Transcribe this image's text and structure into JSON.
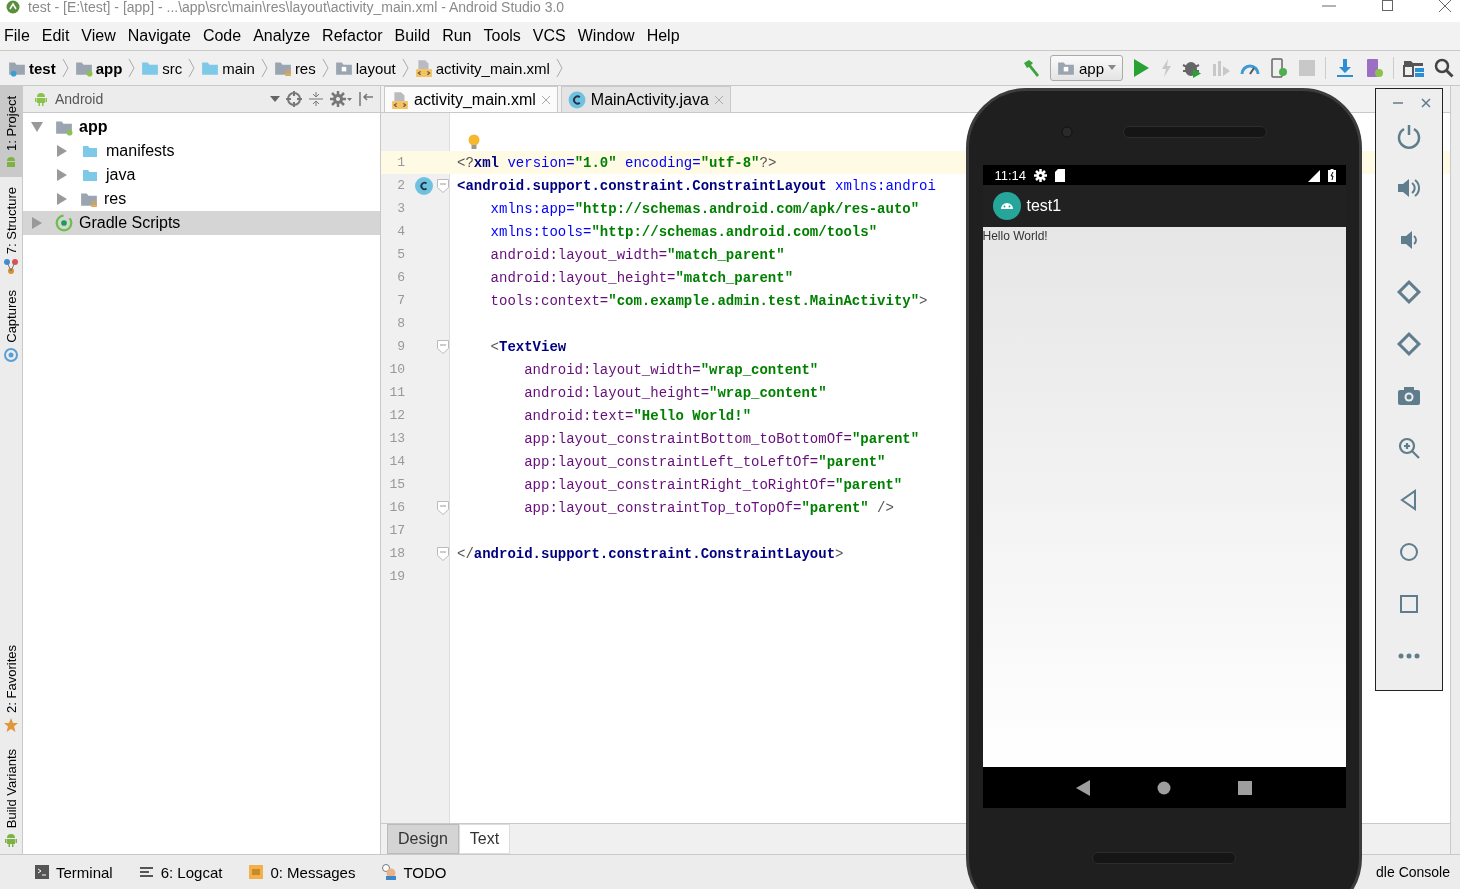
{
  "window": {
    "title": "test - [E:\\test] - [app] - ...\\app\\src\\main\\res\\layout\\activity_main.xml - Android Studio 3.0"
  },
  "menu": [
    "File",
    "Edit",
    "View",
    "Navigate",
    "Code",
    "Analyze",
    "Refactor",
    "Build",
    "Run",
    "Tools",
    "VCS",
    "Window",
    "Help"
  ],
  "breadcrumbs": [
    {
      "label": "test",
      "kind": "project",
      "bold": true
    },
    {
      "label": "app",
      "kind": "module",
      "bold": true
    },
    {
      "label": "src",
      "kind": "folder",
      "bold": false
    },
    {
      "label": "main",
      "kind": "folder",
      "bold": false
    },
    {
      "label": "res",
      "kind": "res",
      "bold": false
    },
    {
      "label": "layout",
      "kind": "layout",
      "bold": false
    },
    {
      "label": "activity_main.xml",
      "kind": "xml",
      "bold": false
    }
  ],
  "run_config": {
    "label": "app"
  },
  "left_tool_tabs": [
    {
      "label": "1: Project",
      "kind": "project",
      "selected": true
    },
    {
      "label": "7: Structure",
      "kind": "structure",
      "selected": false
    },
    {
      "label": "Captures",
      "kind": "captures",
      "selected": false
    },
    {
      "label": "2: Favorites",
      "kind": "favorites",
      "selected": false
    },
    {
      "label": "Build Variants",
      "kind": "variants",
      "selected": false
    }
  ],
  "project_panel": {
    "view": "Android",
    "tree": [
      {
        "label": "app",
        "kind": "module",
        "bold": true,
        "expanded": true,
        "selected": false,
        "children": [
          {
            "label": "manifests",
            "kind": "folder",
            "bold": false,
            "expanded": false,
            "selected": false
          },
          {
            "label": "java",
            "kind": "folder",
            "bold": false,
            "expanded": false,
            "selected": false
          },
          {
            "label": "res",
            "kind": "res",
            "bold": false,
            "expanded": false,
            "selected": false
          }
        ]
      },
      {
        "label": "Gradle Scripts",
        "kind": "gradle",
        "bold": false,
        "expanded": false,
        "selected": true
      }
    ]
  },
  "editor_tabs": [
    {
      "label": "activity_main.xml",
      "kind": "xml",
      "selected": true
    },
    {
      "label": "MainActivity.java",
      "kind": "class",
      "selected": false
    }
  ],
  "code": {
    "lines": [
      {
        "number": "1",
        "current": true,
        "fold": false,
        "class_marker": false,
        "segments": [
          {
            "kind": "punct",
            "text": "<?"
          },
          {
            "kind": "tag",
            "text": "xml "
          },
          {
            "kind": "ns",
            "text": "version="
          },
          {
            "kind": "value",
            "text": "\"1.0\" "
          },
          {
            "kind": "ns",
            "text": "encoding="
          },
          {
            "kind": "value",
            "text": "\"utf-8\""
          },
          {
            "kind": "punct",
            "text": "?>"
          }
        ]
      },
      {
        "number": "2",
        "current": false,
        "fold": true,
        "class_marker": true,
        "segments": [
          {
            "kind": "tag",
            "text": "<android.support.constraint.ConstraintLayout "
          },
          {
            "kind": "ns",
            "text": "xmlns:androi"
          }
        ]
      },
      {
        "number": "3",
        "current": false,
        "fold": false,
        "segments": [
          {
            "kind": "ns",
            "text": "    xmlns:app="
          },
          {
            "kind": "value",
            "text": "\"http://schemas.android.com/apk/res-auto\""
          }
        ]
      },
      {
        "number": "4",
        "current": false,
        "fold": false,
        "segments": [
          {
            "kind": "ns",
            "text": "    xmlns:tools="
          },
          {
            "kind": "value",
            "text": "\"http://schemas.android.com/tools\""
          }
        ]
      },
      {
        "number": "5",
        "current": false,
        "fold": false,
        "segments": [
          {
            "kind": "attr",
            "text": "    android:layout_width="
          },
          {
            "kind": "value",
            "text": "\"match_parent\""
          }
        ]
      },
      {
        "number": "6",
        "current": false,
        "fold": false,
        "segments": [
          {
            "kind": "attr",
            "text": "    android:layout_height="
          },
          {
            "kind": "value",
            "text": "\"match_parent\""
          }
        ]
      },
      {
        "number": "7",
        "current": false,
        "fold": false,
        "segments": [
          {
            "kind": "attr",
            "text": "    tools:context="
          },
          {
            "kind": "value",
            "text": "\"com.example.admin.test.MainActivity\""
          },
          {
            "kind": "punct",
            "text": ">"
          }
        ]
      },
      {
        "number": "8",
        "current": false,
        "fold": false
      },
      {
        "number": "9",
        "current": false,
        "fold": true,
        "segments": [
          {
            "kind": "punct",
            "text": "    <"
          },
          {
            "kind": "tag",
            "text": "TextView"
          }
        ]
      },
      {
        "number": "10",
        "current": false,
        "fold": false,
        "segments": [
          {
            "kind": "attr",
            "text": "        android:layout_width="
          },
          {
            "kind": "value",
            "text": "\"wrap_content\""
          }
        ]
      },
      {
        "number": "11",
        "current": false,
        "fold": false,
        "segments": [
          {
            "kind": "attr",
            "text": "        android:layout_height="
          },
          {
            "kind": "value",
            "text": "\"wrap_content\""
          }
        ]
      },
      {
        "number": "12",
        "current": false,
        "fold": false,
        "segments": [
          {
            "kind": "attr",
            "text": "        android:text="
          },
          {
            "kind": "value",
            "text": "\"Hello World!\""
          }
        ]
      },
      {
        "number": "13",
        "current": false,
        "fold": false,
        "segments": [
          {
            "kind": "attr",
            "text": "        app:layout_constraintBottom_toBottomOf="
          },
          {
            "kind": "value",
            "text": "\"parent\""
          }
        ]
      },
      {
        "number": "14",
        "current": false,
        "fold": false,
        "segments": [
          {
            "kind": "attr",
            "text": "        app:layout_constraintLeft_toLeftOf="
          },
          {
            "kind": "value",
            "text": "\"parent\""
          }
        ]
      },
      {
        "number": "15",
        "current": false,
        "fold": false,
        "segments": [
          {
            "kind": "attr",
            "text": "        app:layout_constraintRight_toRightOf="
          },
          {
            "kind": "value",
            "text": "\"parent\""
          }
        ]
      },
      {
        "number": "16",
        "current": false,
        "fold": true,
        "segments": [
          {
            "kind": "attr",
            "text": "        app:layout_constraintTop_toTopOf="
          },
          {
            "kind": "value",
            "text": "\"parent\" "
          },
          {
            "kind": "punct",
            "text": "/>"
          }
        ]
      },
      {
        "number": "17",
        "current": false,
        "fold": false
      },
      {
        "number": "18",
        "current": false,
        "fold": true,
        "segments": [
          {
            "kind": "punct",
            "text": "</"
          },
          {
            "kind": "tag",
            "text": "android.support.constraint.ConstraintLayout"
          },
          {
            "kind": "punct",
            "text": ">"
          }
        ]
      },
      {
        "number": "19",
        "current": false,
        "fold": false
      }
    ]
  },
  "editor_mode_tabs": [
    {
      "label": "Design",
      "selected": false
    },
    {
      "label": "Text",
      "selected": true
    }
  ],
  "emulator": {
    "status_time": "11:14",
    "app_title": "test1",
    "content_text": "Hello World!"
  },
  "bottom_tools": [
    {
      "label": "Terminal",
      "kind": "terminal"
    },
    {
      "label": "6: Logcat",
      "kind": "logcat"
    },
    {
      "label": "0: Messages",
      "kind": "messages"
    },
    {
      "label": "TODO",
      "kind": "todo"
    },
    {
      "label": "dle Console",
      "kind": "console"
    }
  ]
}
